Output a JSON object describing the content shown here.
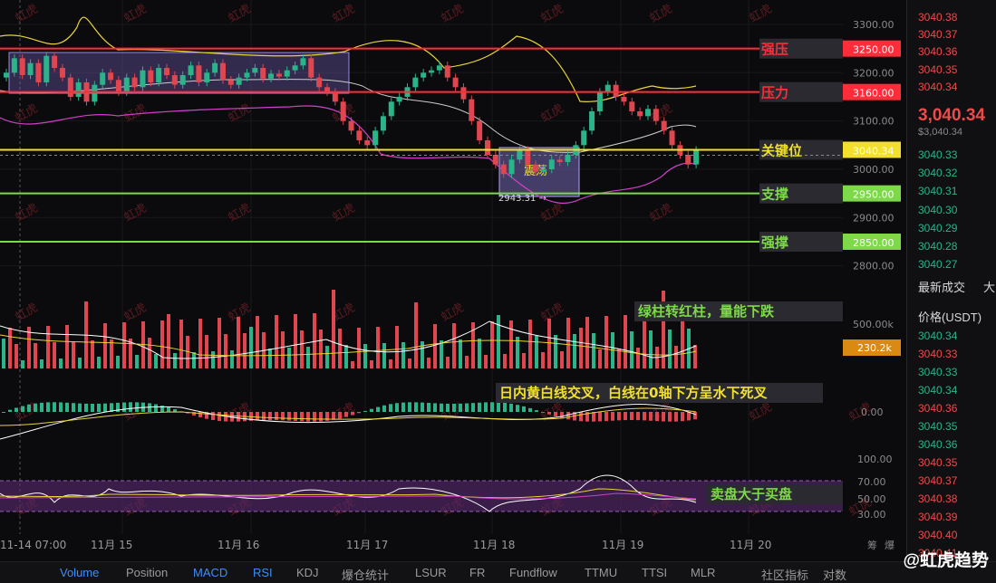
{
  "chart_data": {
    "type": "candlestick",
    "x_ticks": [
      "11-14 07:00",
      "11月 15",
      "11月 16",
      "11月 17",
      "11月 18",
      "11月 19",
      "11月 20"
    ],
    "y_ticks": [
      "3300.00",
      "3250.00",
      "3200.00",
      "3100.00",
      "3040.34",
      "3000.00",
      "2950.00",
      "2900.00",
      "2850.00",
      "2800.00"
    ],
    "ylim": [
      2780,
      3320
    ],
    "last_price": "3040.34",
    "low_marker": "2943.31",
    "range_box_label": "震荡",
    "levels": [
      {
        "name": "强压",
        "value": 3250,
        "label": "3250.00",
        "color": "#ff2d3a"
      },
      {
        "name": "压力",
        "value": 3160,
        "label": "3160.00",
        "color": "#ff2d3a"
      },
      {
        "name": "关键位",
        "value": 3040.34,
        "label": "3040.34",
        "color": "#f2e02c"
      },
      {
        "name": "支撑",
        "value": 2950,
        "label": "2950.00",
        "color": "#7ed94a"
      },
      {
        "name": "强撑",
        "value": 2850,
        "label": "2850.00",
        "color": "#7ed94a"
      }
    ],
    "volume": {
      "axis_label": "500.00k",
      "current": "230.2k",
      "note": "绿柱转红柱，量能下跌"
    },
    "macd": {
      "zero_label": "0.00",
      "note": "日内黄白线交叉，白线在0轴下方呈水下死叉"
    },
    "rsi": {
      "levels": [
        "100.00",
        "70.00",
        "50.00",
        "30.00"
      ],
      "note": "卖盘大于买盘"
    }
  },
  "watermark_text": "虹虎",
  "orderbook": {
    "top_prices": [
      "3040.38",
      "3040.37",
      "3040.36",
      "3040.35",
      "3040.34"
    ],
    "last_price": "3,040.34",
    "last_price_sub": "$3,040.34",
    "prices": [
      "3040.33",
      "3040.32",
      "3040.31",
      "3040.30",
      "3040.29",
      "3040.28",
      "3040.27"
    ],
    "latest_trades_label": "最新成交",
    "latest_trades_label2": "大",
    "price_header": "价格(USDT)",
    "trade_prices": [
      "3040.34",
      "3040.33",
      "3040.33",
      "3040.34",
      "3040.36",
      "3040.35",
      "3040.36",
      "3040.35",
      "3040.37",
      "3040.38",
      "3040.39",
      "3040.40",
      "3040.41"
    ]
  },
  "bottom_tabs": [
    "Volume",
    "Position",
    "MACD",
    "RSI",
    "KDJ",
    "爆仓统计",
    "LSUR",
    "FR",
    "Fundflow",
    "TTMU",
    "TTSI",
    "MLR"
  ],
  "bottom_right": [
    "社区指标",
    "对数"
  ],
  "corner_text": [
    "筹",
    "爆"
  ],
  "brand": "@虹虎趋势"
}
